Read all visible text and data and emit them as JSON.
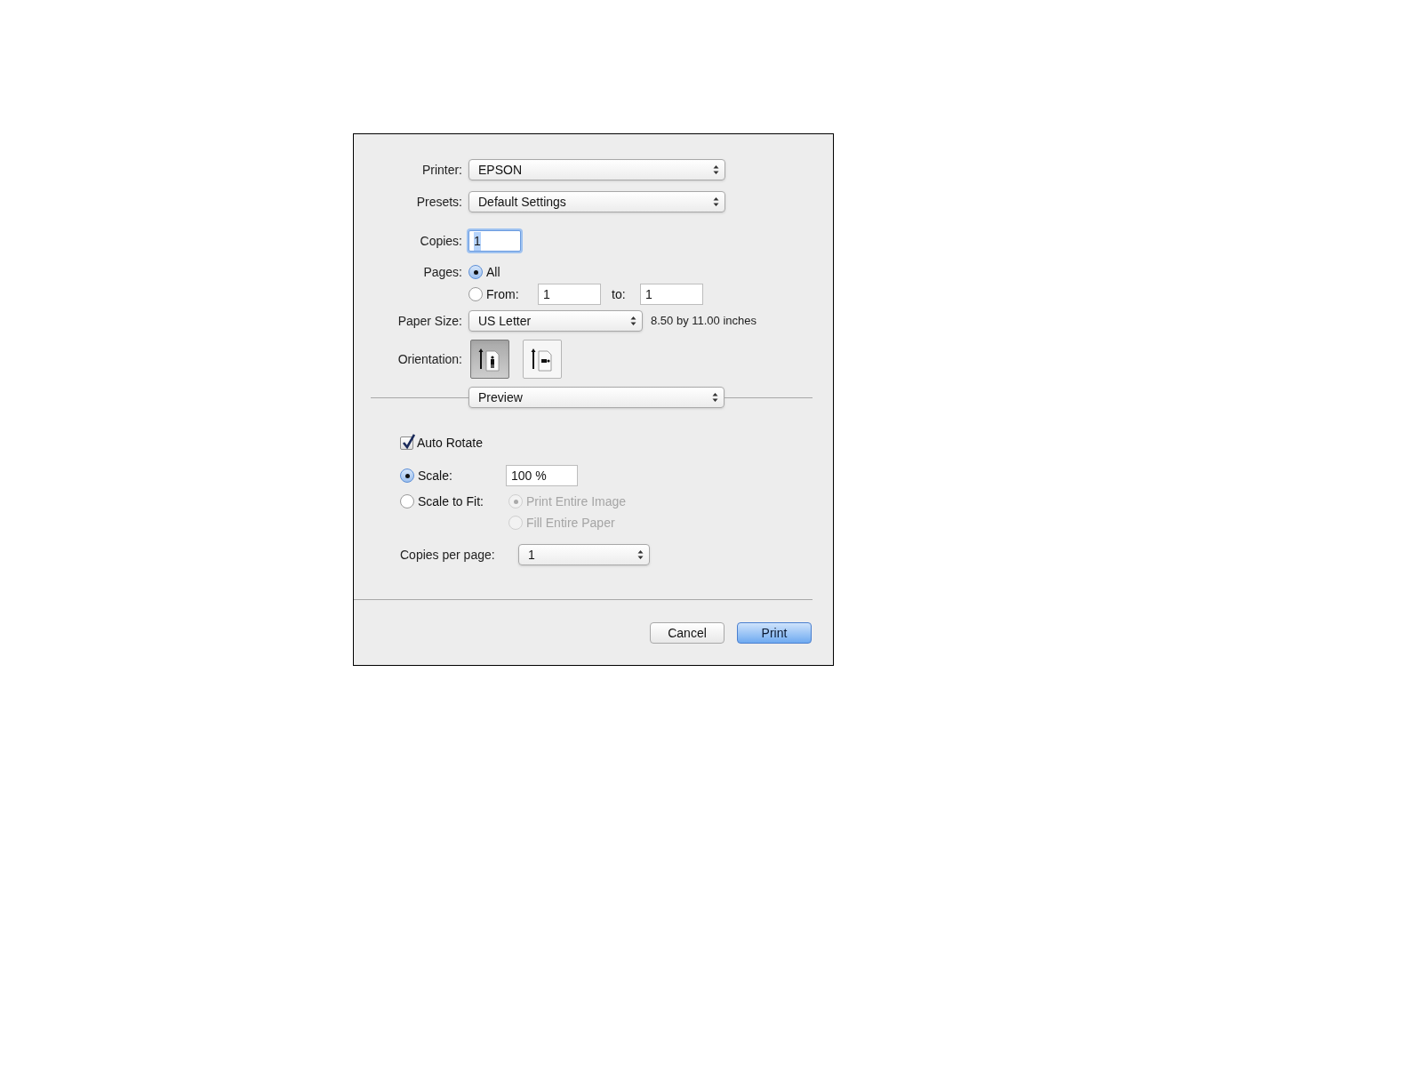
{
  "printer": {
    "label": "Printer:",
    "value": "EPSON"
  },
  "presets": {
    "label": "Presets:",
    "value": "Default Settings"
  },
  "copies": {
    "label": "Copies:",
    "value": "1"
  },
  "pages": {
    "label": "Pages:",
    "options": [
      {
        "label": "All",
        "selected": true
      },
      {
        "label": "From:",
        "selected": false
      }
    ],
    "from": "1",
    "to_label": "to:",
    "to": "1"
  },
  "paper_size": {
    "label": "Paper Size:",
    "value": "US Letter",
    "dimensions": "8.50 by 11.00 inches"
  },
  "orientation": {
    "label": "Orientation:",
    "options": [
      {
        "kind": "portrait",
        "selected": true
      },
      {
        "kind": "landscape",
        "selected": false
      }
    ]
  },
  "section_popup": {
    "value": "Preview"
  },
  "auto_rotate": {
    "label": "Auto Rotate",
    "checked": true
  },
  "scale_modes": [
    {
      "label": "Scale:",
      "selected": true
    },
    {
      "label": "Scale to Fit:",
      "selected": false
    }
  ],
  "scale_value": "100 %",
  "fit_options": [
    {
      "label": "Print Entire Image",
      "selected": true,
      "disabled": true
    },
    {
      "label": "Fill Entire Paper",
      "selected": false,
      "disabled": true
    }
  ],
  "copies_per_page": {
    "label": "Copies per page:",
    "value": "1"
  },
  "buttons": [
    {
      "label": "Cancel",
      "kind": "secondary"
    },
    {
      "label": "Print",
      "kind": "default"
    }
  ]
}
